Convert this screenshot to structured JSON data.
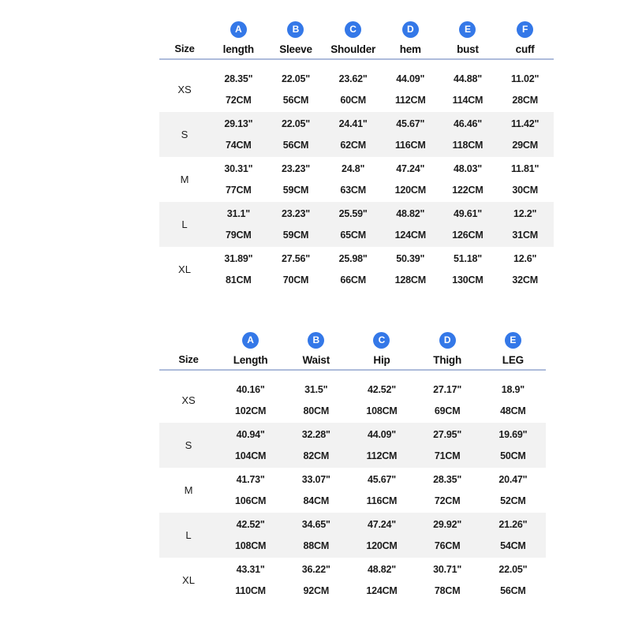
{
  "tables": [
    {
      "name": "top-size-chart",
      "size_header": "Size",
      "columns": [
        {
          "badge": "A",
          "label": "length"
        },
        {
          "badge": "B",
          "label": "Sleeve"
        },
        {
          "badge": "C",
          "label": "Shoulder"
        },
        {
          "badge": "D",
          "label": "hem"
        },
        {
          "badge": "E",
          "label": "bust"
        },
        {
          "badge": "F",
          "label": "cuff"
        }
      ],
      "rows": [
        {
          "size": "XS",
          "striped": false,
          "cells": [
            {
              "inch": "28.35\"",
              "cm": "72CM"
            },
            {
              "inch": "22.05\"",
              "cm": "56CM"
            },
            {
              "inch": "23.62\"",
              "cm": "60CM"
            },
            {
              "inch": "44.09\"",
              "cm": "112CM"
            },
            {
              "inch": "44.88\"",
              "cm": "114CM"
            },
            {
              "inch": "11.02\"",
              "cm": "28CM"
            }
          ]
        },
        {
          "size": "S",
          "striped": true,
          "cells": [
            {
              "inch": "29.13\"",
              "cm": "74CM"
            },
            {
              "inch": "22.05\"",
              "cm": "56CM"
            },
            {
              "inch": "24.41\"",
              "cm": "62CM"
            },
            {
              "inch": "45.67\"",
              "cm": "116CM"
            },
            {
              "inch": "46.46\"",
              "cm": "118CM"
            },
            {
              "inch": "11.42\"",
              "cm": "29CM"
            }
          ]
        },
        {
          "size": "M",
          "striped": false,
          "cells": [
            {
              "inch": "30.31\"",
              "cm": "77CM"
            },
            {
              "inch": "23.23\"",
              "cm": "59CM"
            },
            {
              "inch": "24.8\"",
              "cm": "63CM"
            },
            {
              "inch": "47.24\"",
              "cm": "120CM"
            },
            {
              "inch": "48.03\"",
              "cm": "122CM"
            },
            {
              "inch": "11.81\"",
              "cm": "30CM"
            }
          ]
        },
        {
          "size": "L",
          "striped": true,
          "cells": [
            {
              "inch": "31.1\"",
              "cm": "79CM"
            },
            {
              "inch": "23.23\"",
              "cm": "59CM"
            },
            {
              "inch": "25.59\"",
              "cm": "65CM"
            },
            {
              "inch": "48.82\"",
              "cm": "124CM"
            },
            {
              "inch": "49.61\"",
              "cm": "126CM"
            },
            {
              "inch": "12.2\"",
              "cm": "31CM"
            }
          ]
        },
        {
          "size": "XL",
          "striped": false,
          "cells": [
            {
              "inch": "31.89\"",
              "cm": "81CM"
            },
            {
              "inch": "27.56\"",
              "cm": "70CM"
            },
            {
              "inch": "25.98\"",
              "cm": "66CM"
            },
            {
              "inch": "50.39\"",
              "cm": "128CM"
            },
            {
              "inch": "51.18\"",
              "cm": "130CM"
            },
            {
              "inch": "12.6\"",
              "cm": "32CM"
            }
          ]
        }
      ]
    },
    {
      "name": "bottom-size-chart",
      "size_header": "Size",
      "columns": [
        {
          "badge": "A",
          "label": "Length"
        },
        {
          "badge": "B",
          "label": "Waist"
        },
        {
          "badge": "C",
          "label": "Hip"
        },
        {
          "badge": "D",
          "label": "Thigh"
        },
        {
          "badge": "E",
          "label": "LEG"
        }
      ],
      "rows": [
        {
          "size": "XS",
          "striped": false,
          "cells": [
            {
              "inch": "40.16\"",
              "cm": "102CM"
            },
            {
              "inch": "31.5\"",
              "cm": "80CM"
            },
            {
              "inch": "42.52\"",
              "cm": "108CM"
            },
            {
              "inch": "27.17\"",
              "cm": "69CM"
            },
            {
              "inch": "18.9\"",
              "cm": "48CM"
            }
          ]
        },
        {
          "size": "S",
          "striped": true,
          "cells": [
            {
              "inch": "40.94\"",
              "cm": "104CM"
            },
            {
              "inch": "32.28\"",
              "cm": "82CM"
            },
            {
              "inch": "44.09\"",
              "cm": "112CM"
            },
            {
              "inch": "27.95\"",
              "cm": "71CM"
            },
            {
              "inch": "19.69\"",
              "cm": "50CM"
            }
          ]
        },
        {
          "size": "M",
          "striped": false,
          "cells": [
            {
              "inch": "41.73\"",
              "cm": "106CM"
            },
            {
              "inch": "33.07\"",
              "cm": "84CM"
            },
            {
              "inch": "45.67\"",
              "cm": "116CM"
            },
            {
              "inch": "28.35\"",
              "cm": "72CM"
            },
            {
              "inch": "20.47\"",
              "cm": "52CM"
            }
          ]
        },
        {
          "size": "L",
          "striped": true,
          "cells": [
            {
              "inch": "42.52\"",
              "cm": "108CM"
            },
            {
              "inch": "34.65\"",
              "cm": "88CM"
            },
            {
              "inch": "47.24\"",
              "cm": "120CM"
            },
            {
              "inch": "29.92\"",
              "cm": "76CM"
            },
            {
              "inch": "21.26\"",
              "cm": "54CM"
            }
          ]
        },
        {
          "size": "XL",
          "striped": false,
          "cells": [
            {
              "inch": "43.31\"",
              "cm": "110CM"
            },
            {
              "inch": "36.22\"",
              "cm": "92CM"
            },
            {
              "inch": "48.82\"",
              "cm": "124CM"
            },
            {
              "inch": "30.71\"",
              "cm": "78CM"
            },
            {
              "inch": "22.05\"",
              "cm": "56CM"
            }
          ]
        }
      ]
    }
  ],
  "colors": {
    "badge": "#3478e8",
    "rule": "#aebcdb",
    "stripe": "#f2f2f2",
    "background": "#ffffff",
    "text": "#1c1c1c"
  }
}
